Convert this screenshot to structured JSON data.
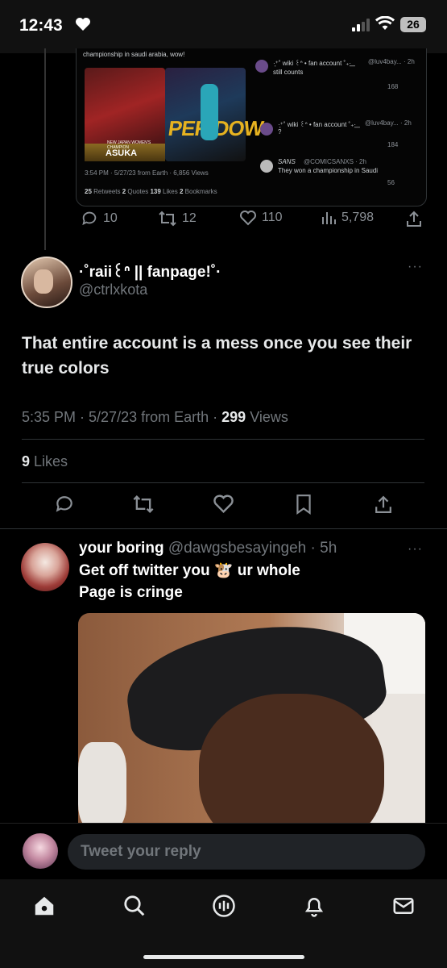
{
  "status_bar": {
    "time": "12:43",
    "battery": "26"
  },
  "embedded": {
    "caption": "championship in saudi arabia, wow!",
    "image_tag": "ASUKA",
    "image_banner_text": "NEW JAPAN WOMEN'S CHAMPION",
    "image_sign": "PERIDOW",
    "meta": "3:54 PM · 5/27/23 from Earth · 6,856 Views",
    "counts": {
      "retweets": "25",
      "retweets_label": "Retweets",
      "quotes": "2",
      "quotes_label": "Quotes",
      "likes": "139",
      "likes_label": "Likes",
      "bookmarks": "2",
      "bookmarks_label": "Bookmarks"
    },
    "replies": [
      {
        "name": "·͙⁺˚ wiki ꒰ᐢ • fan account ˚₊·͟͟",
        "handle": "@luv4bay... · 2h",
        "text": "still counts",
        "views": "168"
      },
      {
        "name": "·͙⁺˚ wiki ꒰ᐢ • fan account ˚₊·͟͟",
        "handle": "@luv4bay... · 2h",
        "text": "?",
        "views": "184"
      },
      {
        "name": "SANS",
        "handle": "@COMICSANXS · 2h",
        "text": "They won a championship in Saudi",
        "views": "56"
      }
    ],
    "quoted_stats": {
      "replies": "10",
      "retweets": "12",
      "likes": "110",
      "views": "5,798"
    }
  },
  "tweet1": {
    "display_name": "·˚raii꒰ᐢ || fanpage!˚·",
    "handle": "@ctrlxkota",
    "more": "···",
    "text": "That entire account is a mess once you see their true colors",
    "time_date": "5:35 PM · 5/27/23 from Earth ·",
    "views": "299",
    "views_label": "Views",
    "likes": "9",
    "likes_label": "Likes"
  },
  "tweet2": {
    "display_name": "your boring",
    "handle": "@dawgsbesayingeh",
    "time": "· 5h",
    "more": "···",
    "text_line1": "Get off twitter you 🐮 ur whole",
    "text_line2": "Page is cringe"
  },
  "reply": {
    "placeholder": "Tweet your reply"
  }
}
